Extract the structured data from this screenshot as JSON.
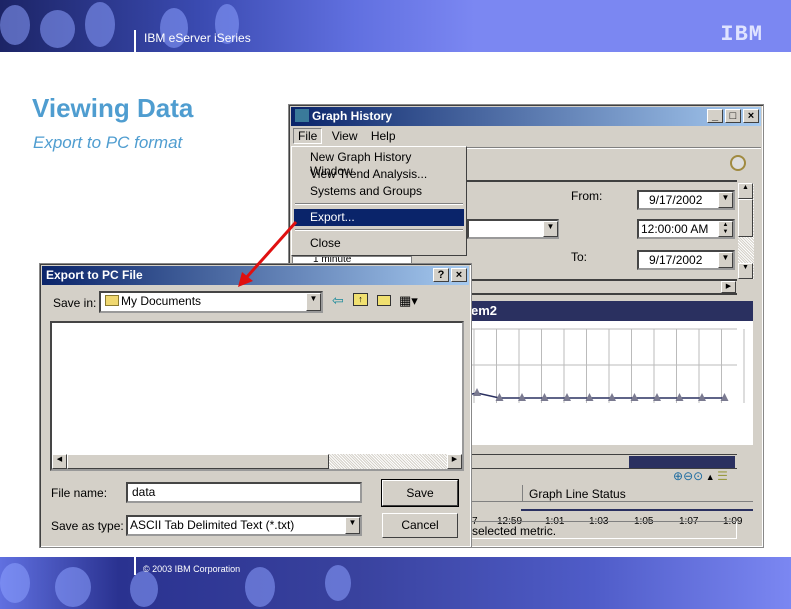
{
  "slide": {
    "header_title": "IBM eServer iSeries",
    "logo": "IBM",
    "title": "Viewing Data",
    "subtitle": "Export to PC format",
    "copyright": "© 2003 IBM Corporation"
  },
  "graph_window": {
    "title": "Graph History",
    "menu": [
      "File",
      "View",
      "Help"
    ],
    "file_menu": [
      "New Graph History Window",
      "View Trend Analysis...",
      "Systems and Groups",
      "Export...",
      "Close"
    ],
    "highlighted": "Export...",
    "interval": "1 minute",
    "from_label": "From:",
    "from_date": "9/17/2002",
    "from_time": "12:00:00 AM",
    "to_label": "To:",
    "to_date": "9/17/2002",
    "panel_title": "em2",
    "x_labels": [
      "7",
      "12:59",
      "1:01",
      "1:03",
      "1:05",
      "1:07",
      "1:09"
    ],
    "column_header": "Graph Line Status",
    "status": "selected metric."
  },
  "export_dialog": {
    "title": "Export to PC File",
    "save_in_label": "Save in:",
    "save_in_value": "My Documents",
    "file_name_label": "File name:",
    "file_name_value": "data",
    "save_as_type_label": "Save as type:",
    "save_as_type_value": "ASCII Tab Delimited Text (*.txt)",
    "save_button": "Save",
    "cancel_button": "Cancel"
  },
  "colors": {
    "accent": "#4f9dd0",
    "menu_highlight": "#0a246a",
    "arrow": "#e01010"
  }
}
